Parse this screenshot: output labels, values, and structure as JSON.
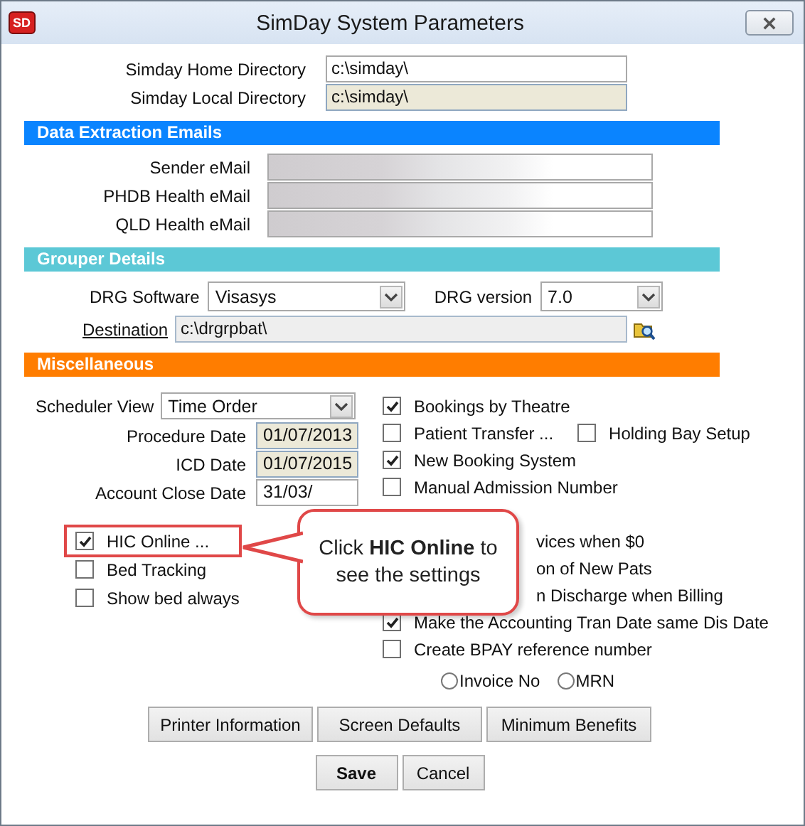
{
  "window": {
    "title": "SimDay System Parameters",
    "app_badge": "SD"
  },
  "directories": [
    {
      "label": "Simday Home Directory",
      "value": "c:\\simday\\",
      "readonly": false
    },
    {
      "label": "Simday Local Directory",
      "value": "c:\\simday\\",
      "readonly": true
    }
  ],
  "data_extraction_emails": {
    "title": "Data Extraction Emails",
    "fields": [
      {
        "label": "Sender eMail"
      },
      {
        "label": "PHDB Health eMail"
      },
      {
        "label": "QLD Health eMail"
      }
    ]
  },
  "grouper_details": {
    "title": "Grouper Details",
    "drg_software": {
      "label": "DRG Software",
      "value": "Visasys"
    },
    "drg_version": {
      "label": "DRG version",
      "value": "7.0"
    },
    "destination": {
      "label": "Destination",
      "value": "c:\\drgrpbat\\"
    }
  },
  "miscellaneous": {
    "title": "Miscellaneous",
    "scheduler_view": {
      "label": "Scheduler View",
      "value": "Time Order"
    },
    "dates": [
      {
        "label": "Procedure Date",
        "value": "01/07/2013",
        "readonly": true
      },
      {
        "label": "ICD Date",
        "value": "01/07/2015",
        "readonly": true
      },
      {
        "label": "Account Close Date",
        "value": "31/03/",
        "readonly": false
      }
    ],
    "left_options": [
      {
        "label": "HIC Online ...",
        "checked": true,
        "highlighted": true
      },
      {
        "label": "Bed Tracking",
        "checked": false,
        "highlighted": false
      },
      {
        "label": "Show bed always",
        "checked": false,
        "highlighted": false
      }
    ],
    "right_options": [
      {
        "kind": "checkbox",
        "label": "Bookings by Theatre",
        "checked": true
      },
      {
        "kind": "pair",
        "label": "Patient Transfer ...",
        "checked": false,
        "second_label": "Holding Bay Setup",
        "second_checked": false
      },
      {
        "kind": "checkbox",
        "label": "New Booking System",
        "checked": true
      },
      {
        "kind": "checkbox",
        "label": "Manual Admission Number",
        "checked": false
      },
      {
        "kind": "covered",
        "label": "vices when $0"
      },
      {
        "kind": "covered",
        "label": "on of New Pats"
      },
      {
        "kind": "covered",
        "label": "n Discharge when Billing"
      },
      {
        "kind": "checkbox",
        "label": "Make the Accounting Tran Date same Dis Date",
        "checked": true
      },
      {
        "kind": "checkbox",
        "label": "Create BPAY reference number",
        "checked": false
      }
    ],
    "radios": [
      {
        "label": "Invoice No",
        "selected": false
      },
      {
        "label": "MRN",
        "selected": false
      }
    ]
  },
  "option_buttons": [
    "Printer Information",
    "Screen Defaults",
    "Minimum Benefits"
  ],
  "dialog_buttons": [
    {
      "label": "Save",
      "default": true
    },
    {
      "label": "Cancel",
      "default": false
    }
  ],
  "callout": {
    "text": "Click **HIC Online** to see the settings"
  }
}
